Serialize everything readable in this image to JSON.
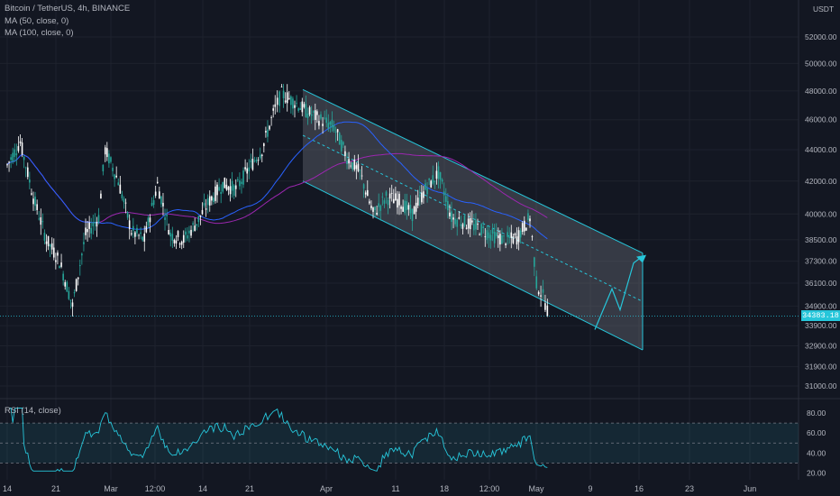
{
  "header": {
    "symbol_line": "Bitcoin / TetherUS, 4h, BINANCE",
    "ma50": "MA (50, close, 0)",
    "ma100": "MA (100, close, 0)",
    "currency": "USDT",
    "last_price": "34383.18"
  },
  "rsi": {
    "label": "RSI (14, close)",
    "ticks": [
      "80.00",
      "60.00",
      "40.00",
      "20.00"
    ]
  },
  "price_axis": {
    "ticks": [
      "52000.00",
      "50000.00",
      "48000.00",
      "46000.00",
      "44000.00",
      "42000.00",
      "40000.00",
      "38500.00",
      "37300.00",
      "36100.00",
      "34900.00",
      "33900.00",
      "32900.00",
      "31900.00",
      "31000.00"
    ]
  },
  "time_axis": {
    "labels": [
      "14",
      "21",
      "Mar",
      "12:00",
      "14",
      "21",
      "Apr",
      "11",
      "18",
      "12:00",
      "May",
      "9",
      "16",
      "23",
      "Jun"
    ]
  },
  "colors": {
    "background": "#131722",
    "up": "#ffffff",
    "down": "#26a69a",
    "ma50": "#2962ff",
    "ma100": "#9c27b0",
    "channel": "#26c6da",
    "rsi_line": "#26c6da"
  },
  "chart_data": {
    "type": "candlestick",
    "title": "Bitcoin / TetherUS, 4h, BINANCE",
    "ylim": [
      31000,
      52000
    ],
    "y_scale": "log",
    "close_path": [
      {
        "x": "Feb 14",
        "close": 43000
      },
      {
        "x": "Feb 16",
        "close": 44500
      },
      {
        "x": "Feb 18",
        "close": 41000
      },
      {
        "x": "Feb 20",
        "close": 38500
      },
      {
        "x": "Feb 22",
        "close": 37300
      },
      {
        "x": "Feb 24",
        "close": 34900
      },
      {
        "x": "Feb 26",
        "close": 38800
      },
      {
        "x": "Feb 28",
        "close": 39800
      },
      {
        "x": "Mar 1",
        "close": 44000
      },
      {
        "x": "Mar 3",
        "close": 42000
      },
      {
        "x": "Mar 5",
        "close": 39000
      },
      {
        "x": "Mar 7",
        "close": 38500
      },
      {
        "x": "Mar 9",
        "close": 41800
      },
      {
        "x": "Mar 11",
        "close": 38800
      },
      {
        "x": "Mar 13",
        "close": 38500
      },
      {
        "x": "Mar 15",
        "close": 39500
      },
      {
        "x": "Mar 17",
        "close": 40800
      },
      {
        "x": "Mar 19",
        "close": 41800
      },
      {
        "x": "Mar 21",
        "close": 41500
      },
      {
        "x": "Mar 23",
        "close": 42800
      },
      {
        "x": "Mar 25",
        "close": 44000
      },
      {
        "x": "Mar 27",
        "close": 46800
      },
      {
        "x": "Mar 28",
        "close": 47800
      },
      {
        "x": "Mar 30",
        "close": 47200
      },
      {
        "x": "Apr 1",
        "close": 46500
      },
      {
        "x": "Apr 3",
        "close": 46000
      },
      {
        "x": "Apr 5",
        "close": 45500
      },
      {
        "x": "Apr 7",
        "close": 43500
      },
      {
        "x": "Apr 9",
        "close": 42500
      },
      {
        "x": "Apr 11",
        "close": 40000
      },
      {
        "x": "Apr 13",
        "close": 41000
      },
      {
        "x": "Apr 15",
        "close": 40800
      },
      {
        "x": "Apr 17",
        "close": 40000
      },
      {
        "x": "Apr 19",
        "close": 41500
      },
      {
        "x": "Apr 21",
        "close": 42500
      },
      {
        "x": "Apr 23",
        "close": 39800
      },
      {
        "x": "Apr 25",
        "close": 39500
      },
      {
        "x": "Apr 27",
        "close": 39200
      },
      {
        "x": "Apr 29",
        "close": 38800
      },
      {
        "x": "May 1",
        "close": 38500
      },
      {
        "x": "May 3",
        "close": 38600
      },
      {
        "x": "May 5",
        "close": 39800
      },
      {
        "x": "May 6",
        "close": 36100
      },
      {
        "x": "May 7",
        "close": 35400
      },
      {
        "x": "May 8",
        "close": 34383.18
      }
    ],
    "series": [
      {
        "name": "MA (50, close, 0)",
        "color": "#2962ff"
      },
      {
        "name": "MA (100, close, 0)",
        "color": "#9c27b0"
      }
    ],
    "last_price": 34383.18,
    "rsi": {
      "name": "RSI (14, close)",
      "ylim": [
        20,
        80
      ],
      "bands": [
        70,
        30
      ]
    }
  }
}
